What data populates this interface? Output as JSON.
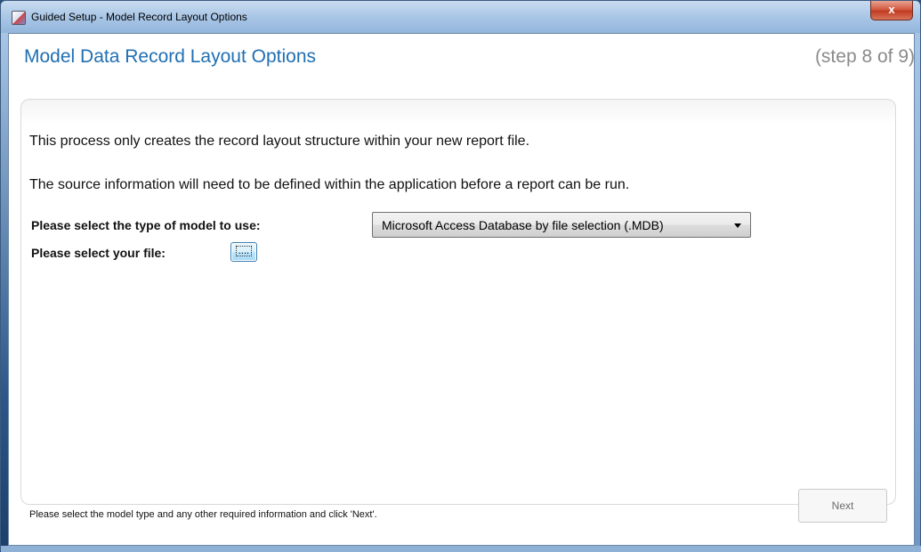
{
  "window": {
    "title": "Guided Setup - Model Record Layout Options",
    "close_label": "x"
  },
  "header": {
    "title": "Model Data Record Layout Options",
    "step": "(step 8 of 9)"
  },
  "content": {
    "info_line_1": "This process only creates the record layout structure within your new report file.",
    "info_line_2": "The source information will need to be defined within the application before a report can be run.",
    "model_type_label": "Please select the type of model to use:",
    "model_type_value": "Microsoft Access Database by file selection (.MDB)",
    "file_label": "Please select your file:",
    "browse_label": "...."
  },
  "footer": {
    "status": "Please select the model type and any other required information and click 'Next'.",
    "next_label": "Next"
  }
}
